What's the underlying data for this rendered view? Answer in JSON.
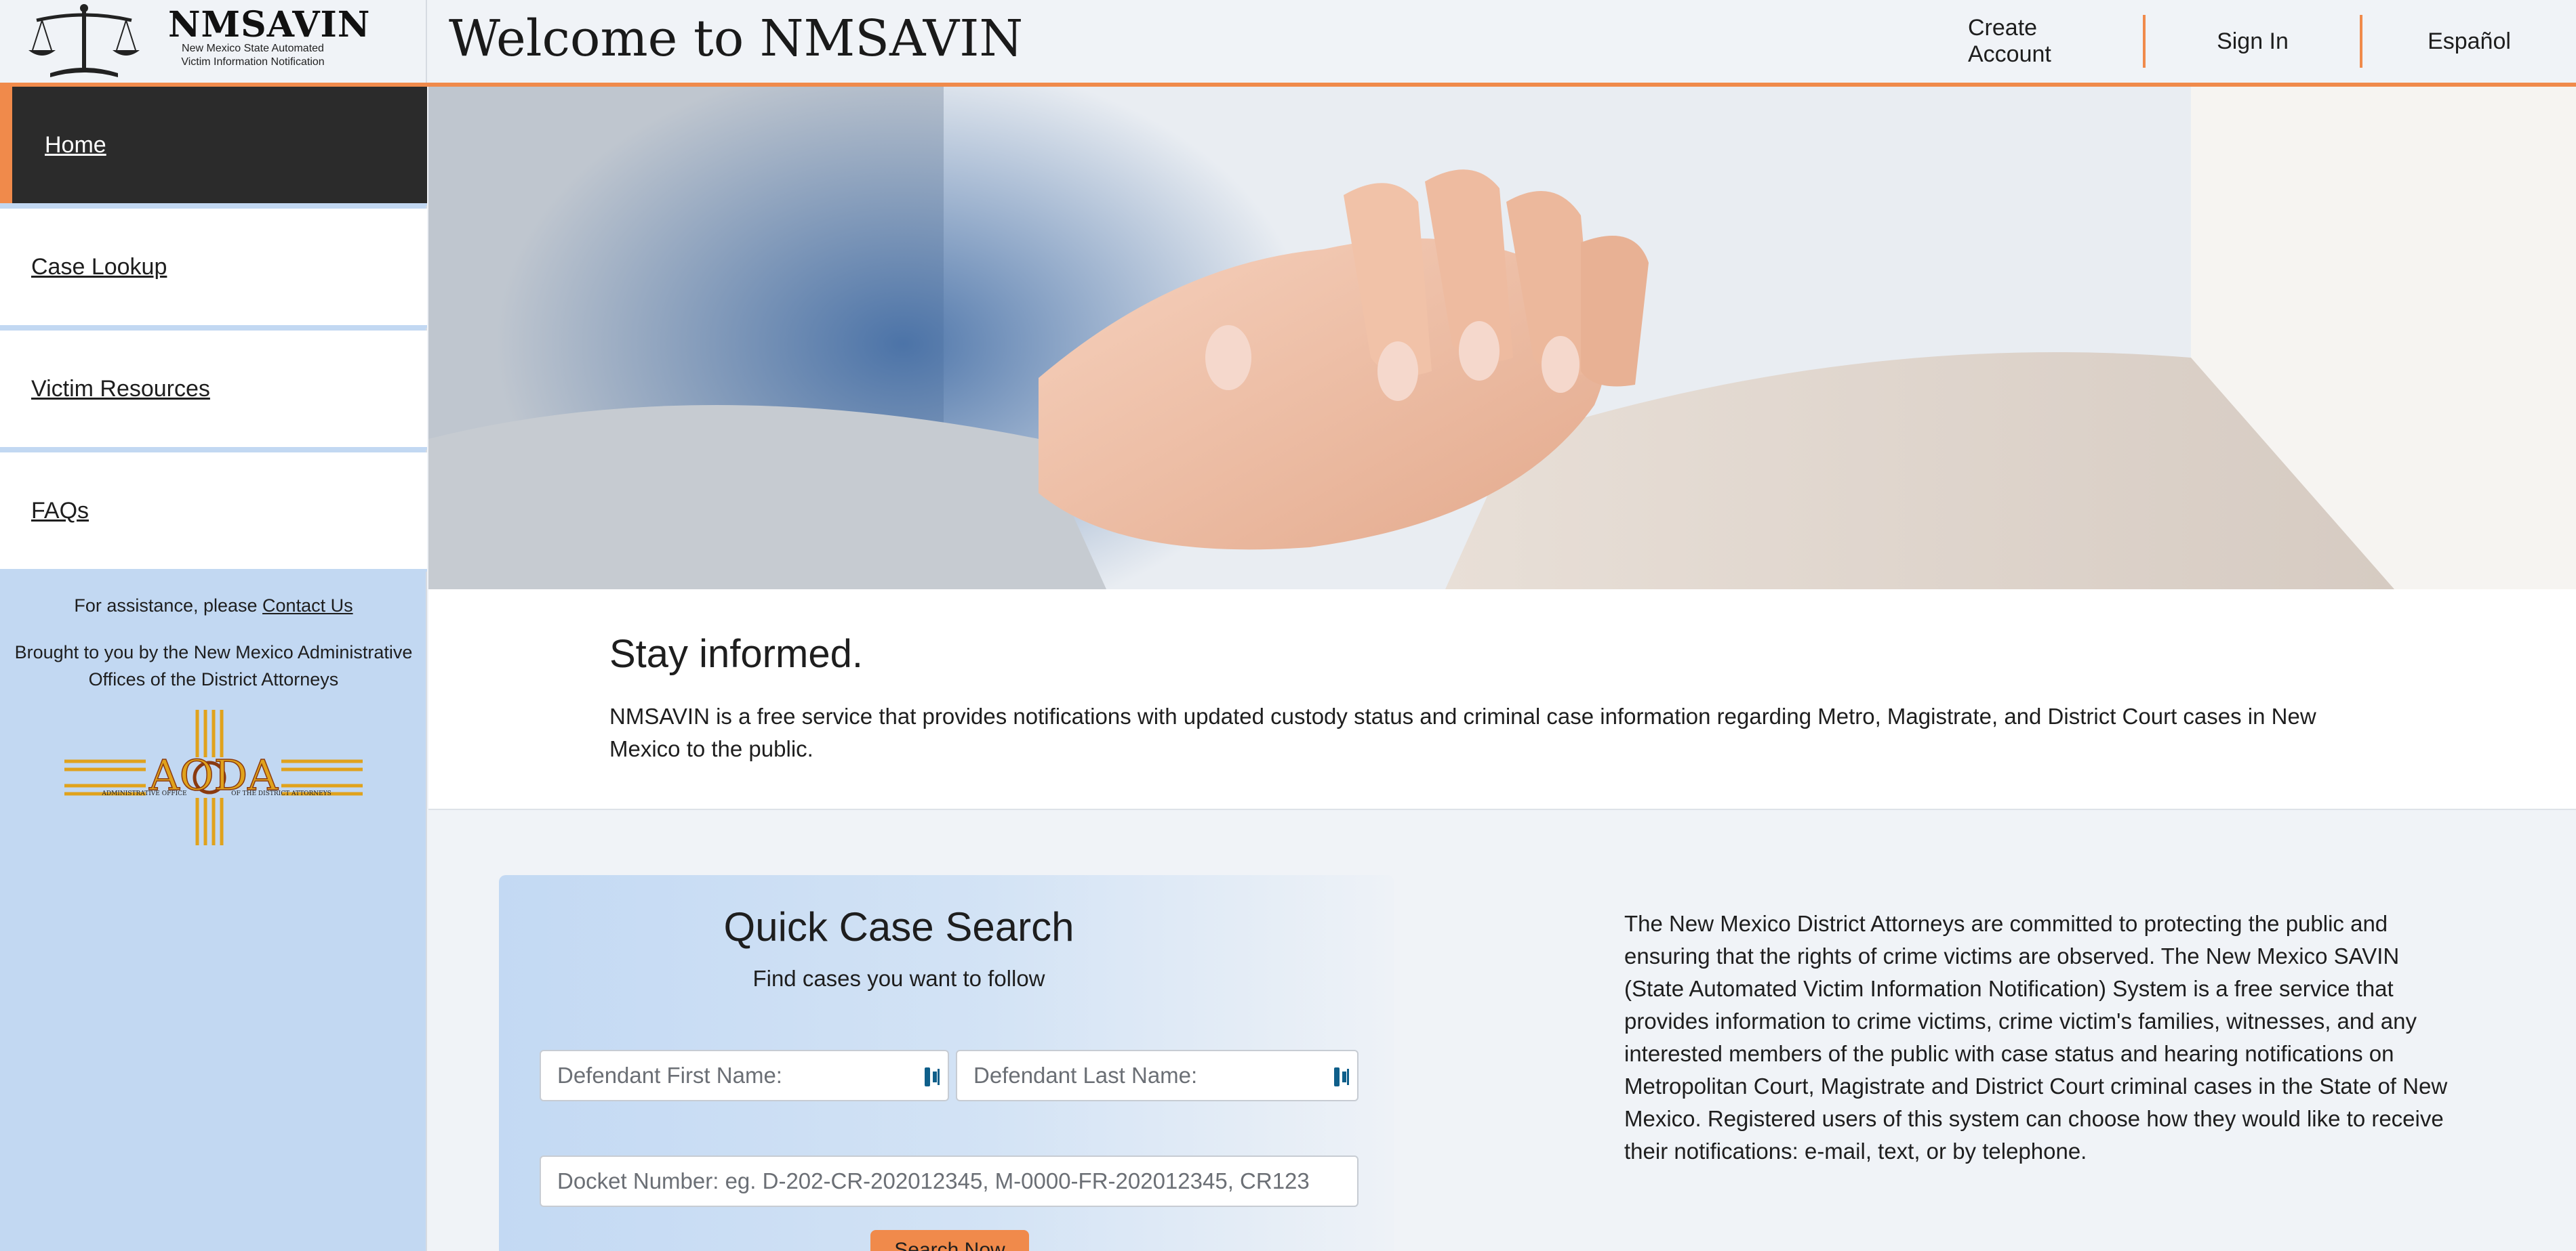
{
  "header": {
    "logo_title": "NMSAVIN",
    "logo_subtitle_line1": "New Mexico State Automated",
    "logo_subtitle_line2": "Victim Information Notification",
    "page_title": "Welcome to NMSAVIN",
    "nav": {
      "create_account": "Create Account",
      "sign_in": "Sign In",
      "espanol": "Español"
    }
  },
  "sidebar": {
    "items": [
      {
        "label": "Home",
        "active": true
      },
      {
        "label": "Case Lookup"
      },
      {
        "label": "Victim Resources"
      },
      {
        "label": "FAQs"
      }
    ],
    "assistance_prefix": "For assistance, please",
    "contact_link": "Contact Us",
    "brought_by": "Brought to you by the New Mexico Administrative Offices of the District Attorneys",
    "aoda_logo_text": "AODA",
    "aoda_left_caption": "ADMINISTRATIVE OFFICE",
    "aoda_right_caption": "OF THE DISTRICT ATTORNEYS"
  },
  "stay": {
    "title": "Stay informed.",
    "text": "NMSAVIN is a free service that provides notifications with updated custody status and criminal case information regarding Metro, Magistrate, and District Court cases in New Mexico to the public."
  },
  "quick_search": {
    "title": "Quick Case Search",
    "subtitle": "Find cases you want to follow",
    "first_name_placeholder": "Defendant First Name:",
    "last_name_placeholder": "Defendant Last Name:",
    "docket_placeholder": "Docket Number:  eg. D-202-CR-202012345, M-0000-FR-202012345, CR123",
    "search_button": "Search Now"
  },
  "mission_text": "The New Mexico District Attorneys are committed to protecting the public and ensuring that the rights of crime victims are observed. The New Mexico SAVIN (State Automated Victim Information Notification) System is a free service that provides information to crime victims, crime victim's families, witnesses, and any interested members of the public with case status and hearing notifications on Metropolitan Court, Magistrate and District Court criminal cases in the State of New Mexico. Registered users of this system can choose how they would like to receive their notifications: e-mail, text, or by telephone.",
  "colors": {
    "accent": "#f08a4b",
    "sidebar_bg": "#c2d8f2",
    "active_nav": "#2b2b2b",
    "page_bg": "#f0f3f7"
  }
}
